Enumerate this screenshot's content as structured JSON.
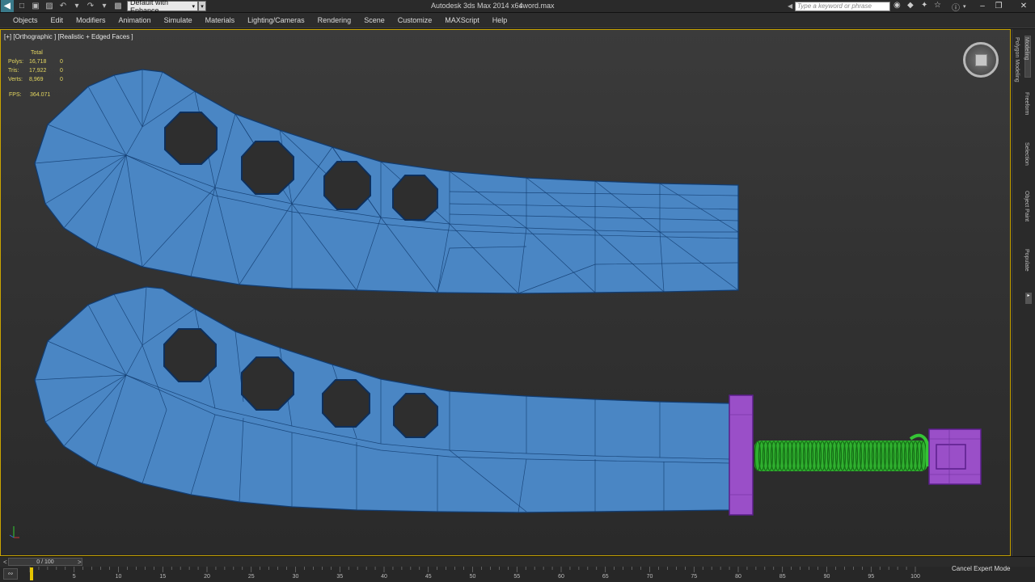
{
  "titlebar": {
    "workspace": "Default with Enhance",
    "app_title": "Autodesk 3ds Max 2014 x64",
    "file_name": "sword.max",
    "search_placeholder": "Type a keyword or phrase"
  },
  "menu": [
    "Objects",
    "Edit",
    "Modifiers",
    "Animation",
    "Simulate",
    "Materials",
    "Lighting/Cameras",
    "Rendering",
    "Scene",
    "Customize",
    "MAXScript",
    "Help"
  ],
  "viewport": {
    "label": "[+] [Orthographic ] [Realistic + Edged Faces ]",
    "stats": {
      "header": "Total",
      "rows": [
        {
          "key": "Polys:",
          "total": "16,718",
          "sel": "0"
        },
        {
          "key": "Tris:",
          "total": "17,922",
          "sel": "0"
        },
        {
          "key": "Verts:",
          "total": "8,969",
          "sel": "0"
        }
      ],
      "fps_key": "FPS:",
      "fps_value": "364.071"
    },
    "colors": {
      "blade": "#4a86c4",
      "wire": "#123c70",
      "guard": "#9a4fc8",
      "grip": "#2fb02f",
      "border": "#c9a400"
    }
  },
  "command_panel": {
    "tabs": [
      "Modeling",
      "Polygon Modeling",
      "Freeform",
      "Selection",
      "Object Paint",
      "Populate"
    ]
  },
  "timeline": {
    "frame_readout": "0 / 100",
    "ticks": [
      "5",
      "10",
      "15",
      "20",
      "25",
      "30",
      "35",
      "40",
      "45",
      "50",
      "55",
      "60",
      "65",
      "70",
      "75",
      "80",
      "85",
      "90",
      "95",
      "100"
    ],
    "status": "Cancel Expert Mode"
  }
}
